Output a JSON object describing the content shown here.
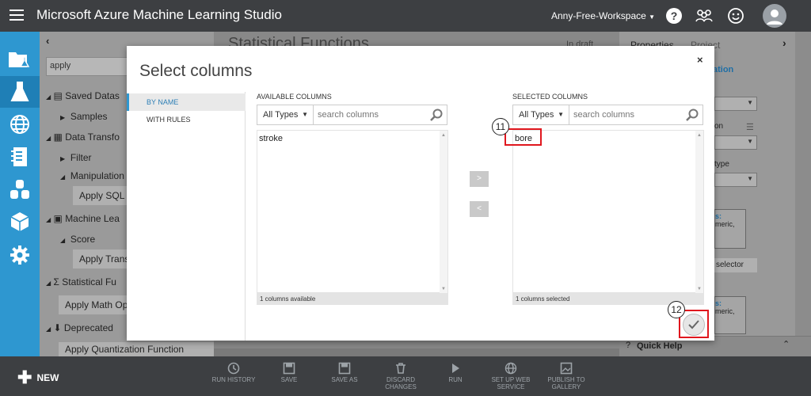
{
  "app": {
    "title": "Microsoft Azure Machine Learning Studio",
    "workspace": "Anny-Free-Workspace"
  },
  "palette": {
    "search_value": "apply",
    "rows": [
      {
        "label": "Saved Datas",
        "level": 0
      },
      {
        "label": "Samples",
        "level": 1
      },
      {
        "label": "Data Transfo",
        "level": 0
      },
      {
        "label": "Filter",
        "level": 1
      },
      {
        "label": "Manipulation",
        "level": 1
      },
      {
        "label": "Machine Lea",
        "level": 0
      },
      {
        "label": "Score",
        "level": 1
      },
      {
        "label": "Statistical Fu",
        "level": 0
      },
      {
        "label": "Deprecated",
        "level": 0
      }
    ],
    "leaves": [
      "Apply SQL T",
      "Apply Transf",
      "Apply Math Op",
      "Apply Quantization Function"
    ]
  },
  "canvas": {
    "title": "Statistical Functions",
    "status": "In draft"
  },
  "properties": {
    "tabs": [
      "Properties",
      "Project"
    ],
    "fragments": [
      "ation",
      "on",
      "type",
      "s:",
      "meric,",
      "selector",
      "s:",
      "meric,"
    ]
  },
  "quick_help": {
    "label": "Quick Help"
  },
  "bottombar": {
    "new_label": "NEW",
    "buttons": [
      {
        "line1": "RUN HISTORY",
        "line2": ""
      },
      {
        "line1": "SAVE",
        "line2": ""
      },
      {
        "line1": "SAVE AS",
        "line2": ""
      },
      {
        "line1": "DISCARD",
        "line2": "CHANGES"
      },
      {
        "line1": "RUN",
        "line2": ""
      },
      {
        "line1": "SET UP WEB",
        "line2": "SERVICE"
      },
      {
        "line1": "PUBLISH TO",
        "line2": "GALLERY"
      }
    ]
  },
  "modal": {
    "title": "Select columns",
    "close": "×",
    "nav": [
      "BY NAME",
      "WITH RULES"
    ],
    "available": {
      "header": "AVAILABLE COLUMNS",
      "type_filter": "All Types",
      "search_placeholder": "search columns",
      "items": [
        "stroke"
      ],
      "footer": "1 columns available"
    },
    "selected": {
      "header": "SELECTED COLUMNS",
      "type_filter": "All Types",
      "search_placeholder": "search columns",
      "items": [
        "bore"
      ],
      "footer": "1 columns selected"
    },
    "move_right": ">",
    "move_left": "<",
    "callouts": [
      "11",
      "12"
    ]
  },
  "colors": {
    "accent": "#2e97d0",
    "topbar": "#3d3f42",
    "highlight": "#e0171e"
  }
}
